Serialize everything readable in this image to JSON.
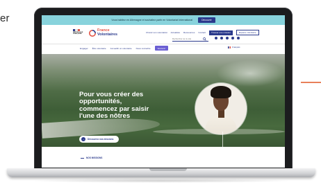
{
  "corner_text": "er",
  "topbar": {
    "message": "Vous habitez en Allemagne et souhaitez partir en Volontariat International",
    "button": "Découvrir"
  },
  "header": {
    "republique_lines": [
      "RÉPUBLIQUE",
      "FRANÇAISE"
    ],
    "logo_line1": "France",
    "logo_line2": "Volontaires",
    "links": [
      "Choisir son volontariat",
      "Actualités",
      "Ressources",
      "Contact"
    ],
    "primary_button": "Trouver une mission",
    "outline_button": "Espace volontaire",
    "search_placeholder": "Rechercher sur le site"
  },
  "nav": {
    "items": [
      "Engager",
      "Être volontaire",
      "Accueillir un volontaire",
      "Nous connaître"
    ],
    "active": "Soutenir",
    "lang": "Français"
  },
  "hero": {
    "title_line1": "Pour vous créer des",
    "title_line2": "opportunités,",
    "title_bold1": "commencez par saisir",
    "title_bold2": "l'une des nôtres",
    "cta": "Découvrez nos missions",
    "cta_icon": "arrow-right-icon"
  },
  "below": {
    "section_label": "NOS MISSIONS"
  },
  "colors": {
    "topbar": "#88d3dc",
    "brand_blue": "#2b3a8c",
    "brand_red": "#e35345",
    "accent_purple": "#6b5fd3",
    "deco_line": "#e8805a"
  }
}
